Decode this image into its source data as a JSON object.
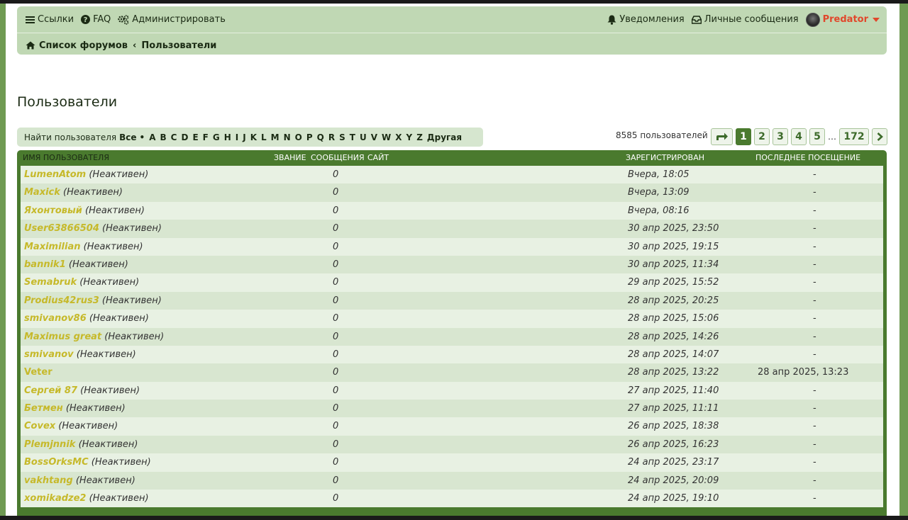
{
  "nav": {
    "links_label": "Ссылки",
    "faq_label": "FAQ",
    "admin_label": "Администрировать",
    "notifications_label": "Уведомления",
    "messages_label": "Личные сообщения",
    "username": "Predator"
  },
  "breadcrumb": {
    "home": "Список форумов",
    "current": "Пользователи"
  },
  "page_title": "Пользователи",
  "finder": {
    "label": "Найти пользователя",
    "all": "Все",
    "letters": [
      "A",
      "B",
      "C",
      "D",
      "E",
      "F",
      "G",
      "H",
      "I",
      "J",
      "K",
      "L",
      "M",
      "N",
      "O",
      "P",
      "Q",
      "R",
      "S",
      "T",
      "U",
      "V",
      "W",
      "X",
      "Y",
      "Z"
    ],
    "other": "Другая"
  },
  "user_count": "8585 пользователей",
  "pagination": {
    "pages": [
      "1",
      "2",
      "3",
      "4",
      "5"
    ],
    "ellipsis": "…",
    "last": "172",
    "current": "1"
  },
  "table": {
    "headers": {
      "name": "Имя пользователя",
      "rank": "Звание",
      "posts": "Сообщения",
      "site": "Сайт",
      "registered": "Зарегистрирован",
      "last_visit": "Последнее посещение"
    },
    "rows": [
      {
        "name": "LumenAtom",
        "status": "(Неактивен)",
        "posts": "0",
        "registered": "Вчера, 18:05",
        "last": "-"
      },
      {
        "name": "Maxick",
        "status": "(Неактивен)",
        "posts": "0",
        "registered": "Вчера, 13:09",
        "last": "-"
      },
      {
        "name": "Яхонтовый",
        "status": "(Неактивен)",
        "posts": "0",
        "registered": "Вчера, 08:16",
        "last": "-"
      },
      {
        "name": "User63866504",
        "status": "(Неактивен)",
        "posts": "0",
        "registered": "30 апр 2025, 23:50",
        "last": "-"
      },
      {
        "name": "Maximilian",
        "status": "(Неактивен)",
        "posts": "0",
        "registered": "30 апр 2025, 19:15",
        "last": "-"
      },
      {
        "name": "bannik1",
        "status": "(Неактивен)",
        "posts": "0",
        "registered": "30 апр 2025, 11:34",
        "last": "-"
      },
      {
        "name": "Semabruk",
        "status": "(Неактивен)",
        "posts": "0",
        "registered": "29 апр 2025, 15:52",
        "last": "-"
      },
      {
        "name": "Prodius42rus3",
        "status": "(Неактивен)",
        "posts": "0",
        "registered": "28 апр 2025, 20:25",
        "last": "-"
      },
      {
        "name": "smivanov86",
        "status": "(Неактивен)",
        "posts": "0",
        "registered": "28 апр 2025, 15:06",
        "last": "-"
      },
      {
        "name": "Maximus great",
        "status": "(Неактивен)",
        "posts": "0",
        "registered": "28 апр 2025, 14:26",
        "last": "-"
      },
      {
        "name": "smivanov",
        "status": "(Неактивен)",
        "posts": "0",
        "registered": "28 апр 2025, 14:07",
        "last": "-"
      },
      {
        "name": "Veter",
        "status": "",
        "posts": "0",
        "registered": "28 апр 2025, 13:22",
        "last": "28 апр 2025, 13:23"
      },
      {
        "name": "Сергей 87",
        "status": "(Неактивен)",
        "posts": "0",
        "registered": "27 апр 2025, 11:40",
        "last": "-"
      },
      {
        "name": "Бетмен",
        "status": "(Неактивен)",
        "posts": "0",
        "registered": "27 апр 2025, 11:11",
        "last": "-"
      },
      {
        "name": "Covex",
        "status": "(Неактивен)",
        "posts": "0",
        "registered": "26 апр 2025, 18:38",
        "last": "-"
      },
      {
        "name": "Plemjnnik",
        "status": "(Неактивен)",
        "posts": "0",
        "registered": "26 апр 2025, 16:23",
        "last": "-"
      },
      {
        "name": "BossOrksMC",
        "status": "(Неактивен)",
        "posts": "0",
        "registered": "24 апр 2025, 23:17",
        "last": "-"
      },
      {
        "name": "vakhtang",
        "status": "(Неактивен)",
        "posts": "0",
        "registered": "24 апр 2025, 20:09",
        "last": "-"
      },
      {
        "name": "xomikadze2",
        "status": "(Неактивен)",
        "posts": "0",
        "registered": "24 апр 2025, 19:10",
        "last": "-"
      }
    ]
  },
  "colors": {
    "accent_green": "#4a7a2e",
    "nav_bg": "#c0d8b4",
    "username_red": "#e1472b",
    "user_link": "#c6b92a"
  }
}
